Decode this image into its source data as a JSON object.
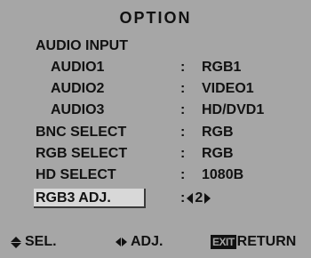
{
  "menu": {
    "title": "OPTION",
    "items": [
      {
        "label": "AUDIO INPUT",
        "value": ""
      },
      {
        "label": "AUDIO1",
        "value": "RGB1"
      },
      {
        "label": "AUDIO2",
        "value": "VIDEO1"
      },
      {
        "label": "AUDIO3",
        "value": "HD/DVD1"
      },
      {
        "label": "BNC SELECT",
        "value": "RGB"
      },
      {
        "label": "RGB SELECT",
        "value": "RGB"
      },
      {
        "label": "HD SELECT",
        "value": "1080B"
      },
      {
        "label": "RGB3 ADJ.",
        "value": "2"
      }
    ],
    "separator": ":"
  },
  "footer": {
    "select_label": "SEL.",
    "adjust_label": "ADJ.",
    "exit_key": "EXIT",
    "return_label": "RETURN"
  },
  "icons": {
    "select": "up-down-arrows-icon",
    "adjust": "left-right-arrows-icon",
    "exit": "exit-key-icon"
  },
  "colors": {
    "panel": "#a6a6a6",
    "text": "#111111",
    "selection": "#d8d8d8"
  }
}
